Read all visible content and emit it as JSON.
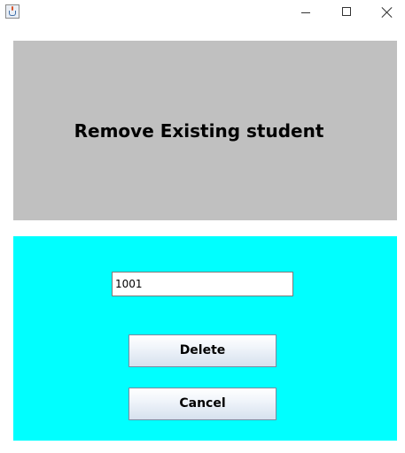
{
  "window": {
    "icon": "java-cup-icon",
    "controls": [
      "minimize-icon",
      "maximize-icon",
      "close-icon"
    ]
  },
  "header": {
    "title": "Remove Existing student",
    "background": "#c0c0c0"
  },
  "form": {
    "background": "#00ffff",
    "student_id_value": "1001",
    "delete_label": "Delete",
    "cancel_label": "Cancel"
  }
}
